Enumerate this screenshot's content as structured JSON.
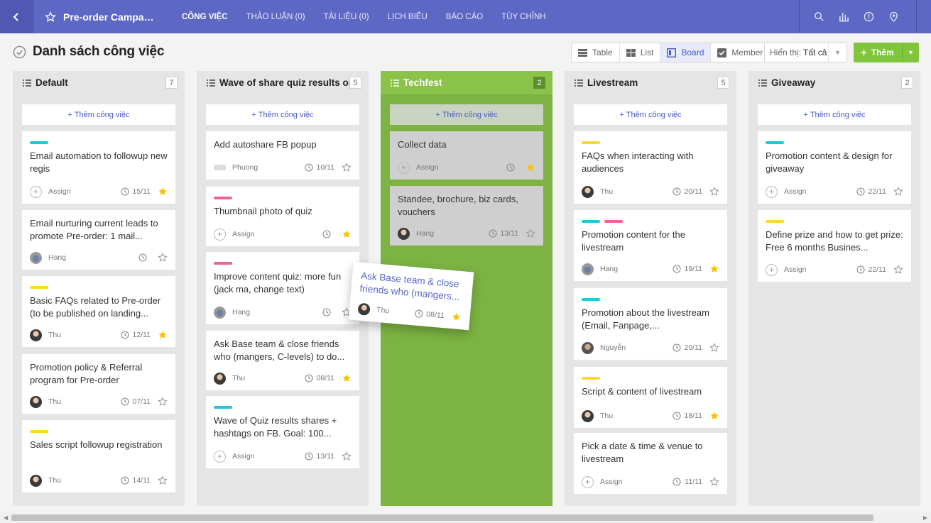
{
  "nav": {
    "project_title": "Pre-order Campaig...",
    "items": [
      {
        "label": "CÔNG VIỆC",
        "active": true
      },
      {
        "label": "THẢO LUẬN (0)",
        "active": false
      },
      {
        "label": "TÀI LIỆU (0)",
        "active": false
      },
      {
        "label": "LỊCH BIỂU",
        "active": false
      },
      {
        "label": "BÁO CÁO",
        "active": false
      },
      {
        "label": "TÙY CHỈNH",
        "active": false
      }
    ],
    "icons": [
      "search-icon",
      "chart-icon",
      "help-icon",
      "location-icon"
    ]
  },
  "page": {
    "title": "Danh sách công việc",
    "views": [
      "Table",
      "List",
      "Board",
      "Member"
    ],
    "active_view": "Board",
    "filter_label": "Hiển thị:",
    "filter_value": "Tất cả",
    "add_label": "Thêm"
  },
  "colors": {
    "accent": "#5d67c4",
    "green": "#80c53b",
    "tag_cyan": "#26c6da",
    "tag_yellow": "#fdd835",
    "tag_pink": "#f06292",
    "star_on": "#f9c200"
  },
  "add_task_label": "+ Thêm công việc",
  "columns": [
    {
      "name": "Default",
      "count": "7",
      "cards": [
        {
          "tags": [
            "cyan"
          ],
          "title": "Email automation to followup new regis",
          "who": "Assign",
          "avatar": "assign",
          "date": "15/11",
          "starred": true
        },
        {
          "tags": [],
          "title": "Email nurturing current leads to promote Pre-order: 1 mail...",
          "who": "Hang",
          "avatar": "hang",
          "date": "",
          "starred": false
        },
        {
          "tags": [
            "yellow"
          ],
          "title": "Basic FAQs related to Pre-order (to be published on landing...",
          "who": "Thu",
          "avatar": "thu",
          "date": "12/11",
          "starred": true
        },
        {
          "tags": [],
          "title": "Promotion policy & Referral program for Pre-order",
          "who": "Thu",
          "avatar": "thu",
          "date": "07/11",
          "starred": false
        },
        {
          "tags": [
            "yellow"
          ],
          "title": "Sales script followup registration",
          "who": "Thu",
          "avatar": "thu",
          "date": "14/11",
          "starred": false
        }
      ]
    },
    {
      "name": "Wave of share quiz results on FI",
      "count": "5",
      "cards": [
        {
          "tags": [],
          "title": "Add autoshare FB popup",
          "who": "Phuong",
          "avatar": "phuong",
          "date": "10/11",
          "starred": false
        },
        {
          "tags": [
            "pink"
          ],
          "title": "Thumbnail photo of quiz",
          "who": "Assign",
          "avatar": "assign",
          "date": "",
          "starred": true
        },
        {
          "tags": [
            "pink"
          ],
          "title": "Improve content quiz: more fun (jack ma, change text)",
          "who": "Hang",
          "avatar": "hang",
          "date": "",
          "starred": false
        },
        {
          "tags": [],
          "title": "Ask Base team & close friends who (mangers, C-levels) to do...",
          "who": "Thu",
          "avatar": "thu",
          "date": "08/11",
          "starred": true
        },
        {
          "tags": [
            "cyan"
          ],
          "title": "Wave of Quiz results shares + hashtags on FB. Goal: 100...",
          "who": "Assign",
          "avatar": "assign",
          "date": "13/11",
          "starred": false
        }
      ]
    },
    {
      "name": "Techfest",
      "count": "2",
      "cards": [
        {
          "tags": [],
          "title": "Collect data",
          "who": "Assign",
          "avatar": "assign",
          "date": "",
          "starred": true
        },
        {
          "tags": [],
          "title": "Standee, brochure, biz cards, vouchers",
          "who": "Hang",
          "avatar": "thu",
          "date": "13/11",
          "starred": false
        }
      ]
    },
    {
      "name": "Livestream",
      "count": "5",
      "cards": [
        {
          "tags": [
            "yellow"
          ],
          "title": "FAQs when interacting with audiences",
          "who": "Thu",
          "avatar": "thu",
          "date": "20/11",
          "starred": false
        },
        {
          "tags": [
            "cyan",
            "pink"
          ],
          "title": "Promotion content for the livestream",
          "who": "Hang",
          "avatar": "hang",
          "date": "19/11",
          "starred": true
        },
        {
          "tags": [
            "cyan"
          ],
          "title": "Promotion about the livestream (Email, Fanpage,...",
          "who": "Nguyễn",
          "avatar": "nguyen",
          "date": "20/11",
          "starred": false
        },
        {
          "tags": [
            "yellow"
          ],
          "title": "Script & content of livestream",
          "who": "Thu",
          "avatar": "thu",
          "date": "18/11",
          "starred": true
        },
        {
          "tags": [],
          "title": "Pick a date & time & venue to livestream",
          "who": "Assign",
          "avatar": "assign",
          "date": "11/11",
          "starred": false
        }
      ]
    },
    {
      "name": "Giveaway",
      "count": "2",
      "cards": [
        {
          "tags": [
            "cyan"
          ],
          "title": "Promotion content & design for giveaway",
          "who": "Assign",
          "avatar": "assign",
          "date": "22/11",
          "starred": false
        },
        {
          "tags": [
            "yellow"
          ],
          "title": "Define prize and how to get prize: Free 6 months Busines...",
          "who": "Assign",
          "avatar": "assign",
          "date": "22/11",
          "starred": false
        }
      ]
    }
  ],
  "dragging_card": {
    "title": "Ask Base team & close friends who (mangers...",
    "who": "Thu",
    "date": "08/11",
    "starred": true
  }
}
